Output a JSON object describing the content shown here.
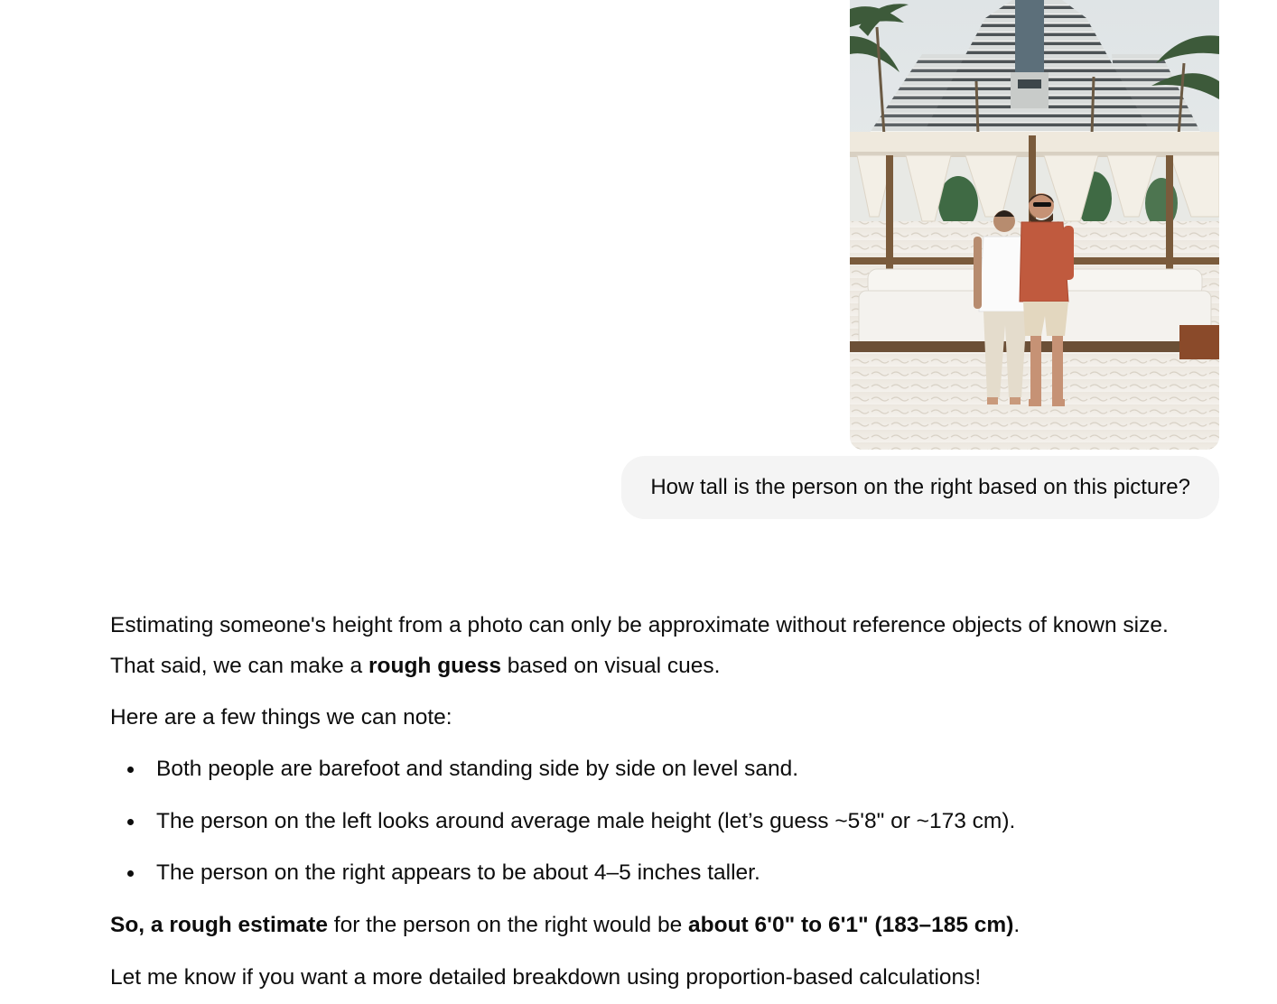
{
  "user_message": {
    "attachment": {
      "kind": "photo",
      "description_icon": "photo-icon"
    },
    "text": "How tall is the person on the right based on this picture?"
  },
  "assistant_message": {
    "intro": {
      "part1": "Estimating someone's height from a photo can only be approximate without reference objects of known size. That said, we can make a ",
      "bold": "rough guess",
      "part2": " based on visual cues."
    },
    "note": "Here are a few things we can note:",
    "bullets": [
      "Both people are barefoot and standing side by side on level sand.",
      "The person on the left looks around average male height (let’s guess ~5'8\" or ~173 cm).",
      "The person on the right appears to be about 4–5 inches taller."
    ],
    "estimate": {
      "bold1": "So, a rough estimate",
      "mid": " for the person on the right would be ",
      "bold2": "about 6'0\" to 6'1\" (183–185 cm)",
      "end": "."
    },
    "closing": "Let me know if you want a more detailed breakdown using proportion-based calculations!"
  },
  "colors": {
    "bubble_bg": "#f4f4f4",
    "text": "#0d0d0d",
    "background": "#ffffff"
  }
}
